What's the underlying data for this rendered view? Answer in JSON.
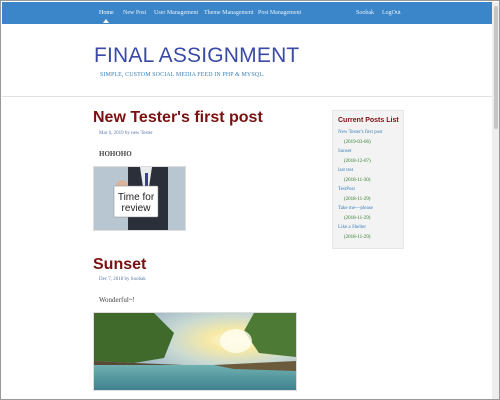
{
  "nav": {
    "items": [
      "Home",
      "New Post",
      "User Management",
      "Theme Management",
      "Post Management"
    ],
    "right": [
      "Soobak",
      "LogOut"
    ]
  },
  "header": {
    "title": "FINAL ASSIGNMENT",
    "tagline": "SIMPLE, CUSTOM SOCIAL MEDIA FEED IN PHP & MYSQL."
  },
  "posts": [
    {
      "title": "New Tester's first post",
      "meta": "Mar 6, 2019 by new Tester",
      "body": "HOHOHO",
      "image_caption": "Time for review"
    },
    {
      "title": "Sunset",
      "meta": "Dec 7, 2018 by Soobak",
      "body": "Wonderful~!"
    }
  ],
  "sidebar": {
    "title": "Current Posts List",
    "items": [
      {
        "label": "New Tester's first post",
        "date": "(2019-03-06)"
      },
      {
        "label": "Sunset",
        "date": "(2018-12-07)"
      },
      {
        "label": "last test",
        "date": "(2018-11-30)"
      },
      {
        "label": "TestPost",
        "date": "(2018-11-29)"
      },
      {
        "label": "Take me~~please",
        "date": "(2018-11-29)"
      },
      {
        "label": "Like a Shelter",
        "date": "(2018-11-29)"
      }
    ]
  }
}
